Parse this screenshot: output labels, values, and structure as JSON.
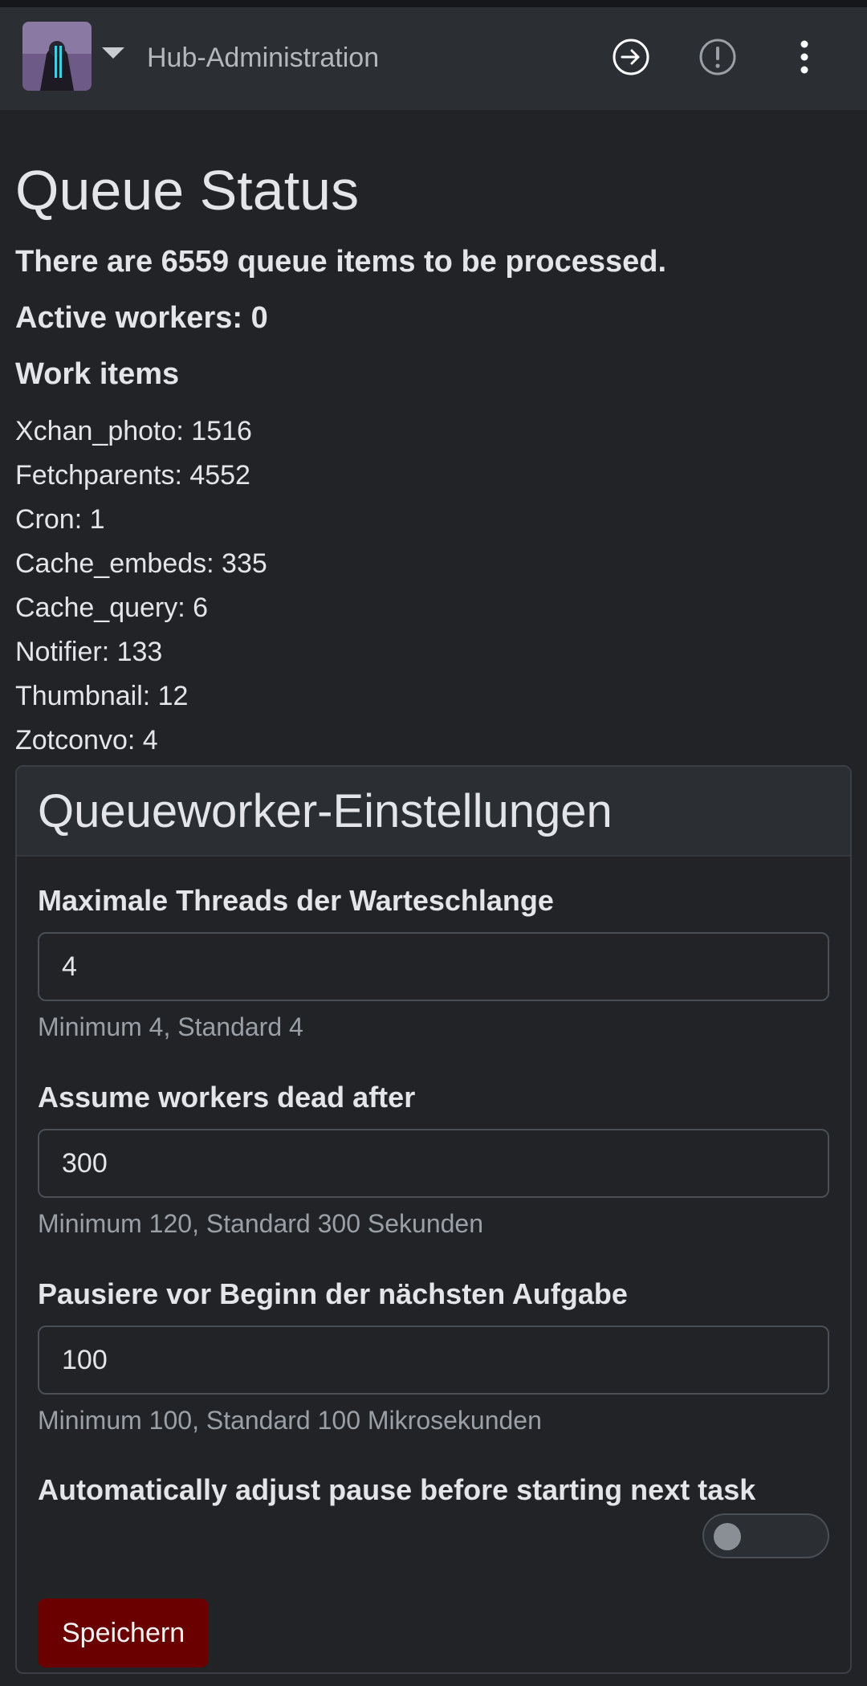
{
  "navbar": {
    "title": "Hub-Administration",
    "icons": [
      "avatar",
      "chevron-down-icon",
      "login-arrow-icon",
      "exclamation-circle-icon",
      "more-vertical-icon"
    ]
  },
  "main": {
    "title": "Queue Status",
    "queue_summary": "There are 6559 queue items to be processed.",
    "active_workers": "Active workers: 0",
    "work_items_heading": "Work items",
    "work_items": [
      "Xchan_photo: 1516",
      "Fetchparents: 4552",
      "Cron: 1",
      "Cache_embeds: 335",
      "Cache_query: 6",
      "Notifier: 133",
      "Thumbnail: 12",
      "Zotconvo: 4"
    ]
  },
  "settings": {
    "title": "Queueworker-Einstellungen",
    "max_threads": {
      "label": "Maximale Threads der Warteschlange",
      "value": "4",
      "help": "Minimum 4, Standard 4"
    },
    "dead_after": {
      "label": "Assume workers dead after",
      "value": "300",
      "help": "Minimum 120, Standard 300 Sekunden"
    },
    "pause": {
      "label": "Pausiere vor Beginn der nächsten Aufgabe",
      "value": "100",
      "help": "Minimum 100, Standard 100 Mikrosekunden"
    },
    "auto_adjust": {
      "label": "Automatically adjust pause before starting next task",
      "enabled": false
    },
    "save_label": "Speichern"
  },
  "colors": {
    "background": "#212327",
    "navbar": "#2b2e33",
    "save_button": "#6b0000"
  }
}
